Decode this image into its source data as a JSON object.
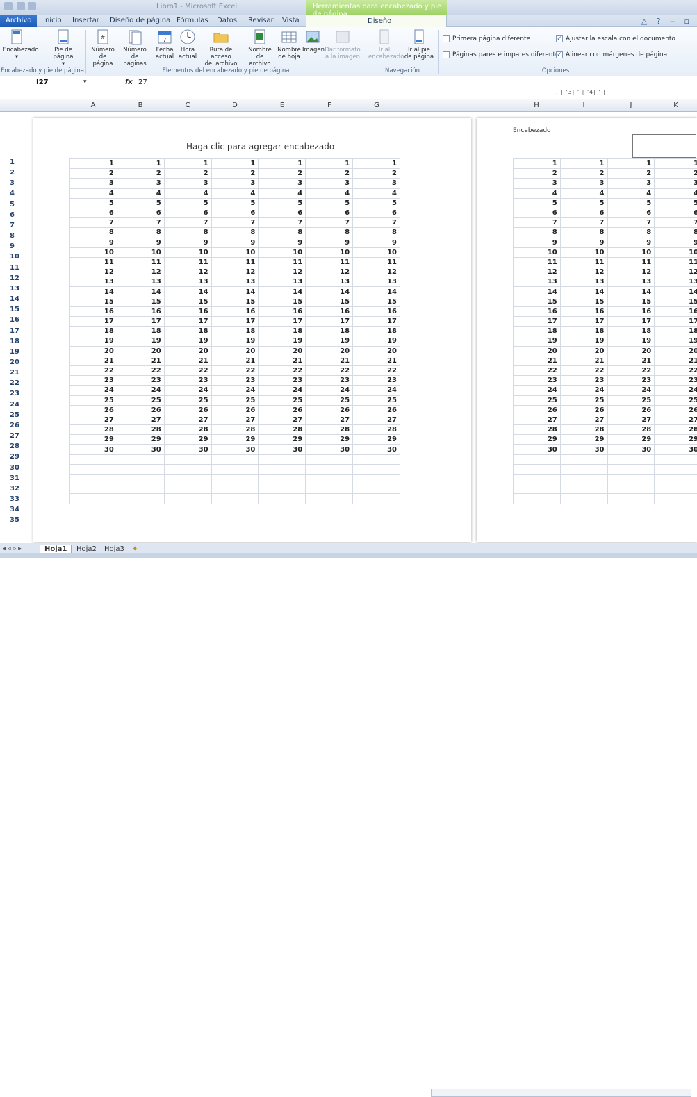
{
  "app": {
    "title": "Libro1 - Microsoft Excel",
    "context_tab": "Herramientas para encabezado y pie de página"
  },
  "tabs": [
    {
      "label": "Archivo"
    },
    {
      "label": "Inicio"
    },
    {
      "label": "Insertar"
    },
    {
      "label": "Diseño de página"
    },
    {
      "label": "Fórmulas"
    },
    {
      "label": "Datos"
    },
    {
      "label": "Revisar"
    },
    {
      "label": "Vista"
    },
    {
      "label": "Diseño"
    }
  ],
  "ribbon": {
    "groups": [
      {
        "label": "Encabezado y pie de página"
      },
      {
        "label": "Elementos del encabezado y pie de página"
      },
      {
        "label": "Navegación"
      },
      {
        "label": "Opciones"
      }
    ],
    "buttons": [
      {
        "label": "Encabezado",
        "sub": "▾"
      },
      {
        "label": "Pie de",
        "sub": "página ▾"
      },
      {
        "label": "Número",
        "sub": "de página"
      },
      {
        "label": "Número",
        "sub": "de páginas"
      },
      {
        "label": "Fecha",
        "sub": "actual"
      },
      {
        "label": "Hora",
        "sub": "actual"
      },
      {
        "label": "Ruta de acceso",
        "sub": "del archivo"
      },
      {
        "label": "Nombre",
        "sub": "de archivo"
      },
      {
        "label": "Nombre",
        "sub": "de hoja"
      },
      {
        "label": "Imagen",
        "sub": ""
      },
      {
        "label": "Dar formato",
        "sub": "a la imagen"
      },
      {
        "label": "Ir al",
        "sub": "encabezado"
      },
      {
        "label": "Ir al pie",
        "sub": "de página"
      }
    ],
    "options": [
      {
        "label": "Primera página diferente",
        "checked": false
      },
      {
        "label": "Ajustar la escala con el documento",
        "checked": true
      },
      {
        "label": "Páginas pares e impares diferentes",
        "checked": false
      },
      {
        "label": "Alinear con márgenes de página",
        "checked": true
      }
    ]
  },
  "formula": {
    "namebox": "I27",
    "fx": "fx",
    "value": "27"
  },
  "columns": [
    "A",
    "B",
    "C",
    "D",
    "E",
    "F",
    "G",
    "H",
    "I",
    "J",
    "K"
  ],
  "ruler": ". | '3| ' | '4| ' |",
  "page": {
    "header_hint": "Haga clic para agregar encabezado",
    "right_header_label": "Encabezado"
  },
  "rows": [
    1,
    2,
    3,
    4,
    5,
    6,
    7,
    8,
    9,
    10,
    11,
    12,
    13,
    14,
    15,
    16,
    17,
    18,
    19,
    20,
    21,
    22,
    23,
    24,
    25,
    26,
    27,
    28,
    29,
    30,
    31,
    32,
    33,
    34,
    35
  ],
  "data_rows": 30,
  "sheets": [
    {
      "label": "Hoja1"
    },
    {
      "label": "Hoja2"
    },
    {
      "label": "Hoja3"
    }
  ],
  "colors": {
    "accent": "#1c5cb5",
    "context": "#9ed265"
  }
}
